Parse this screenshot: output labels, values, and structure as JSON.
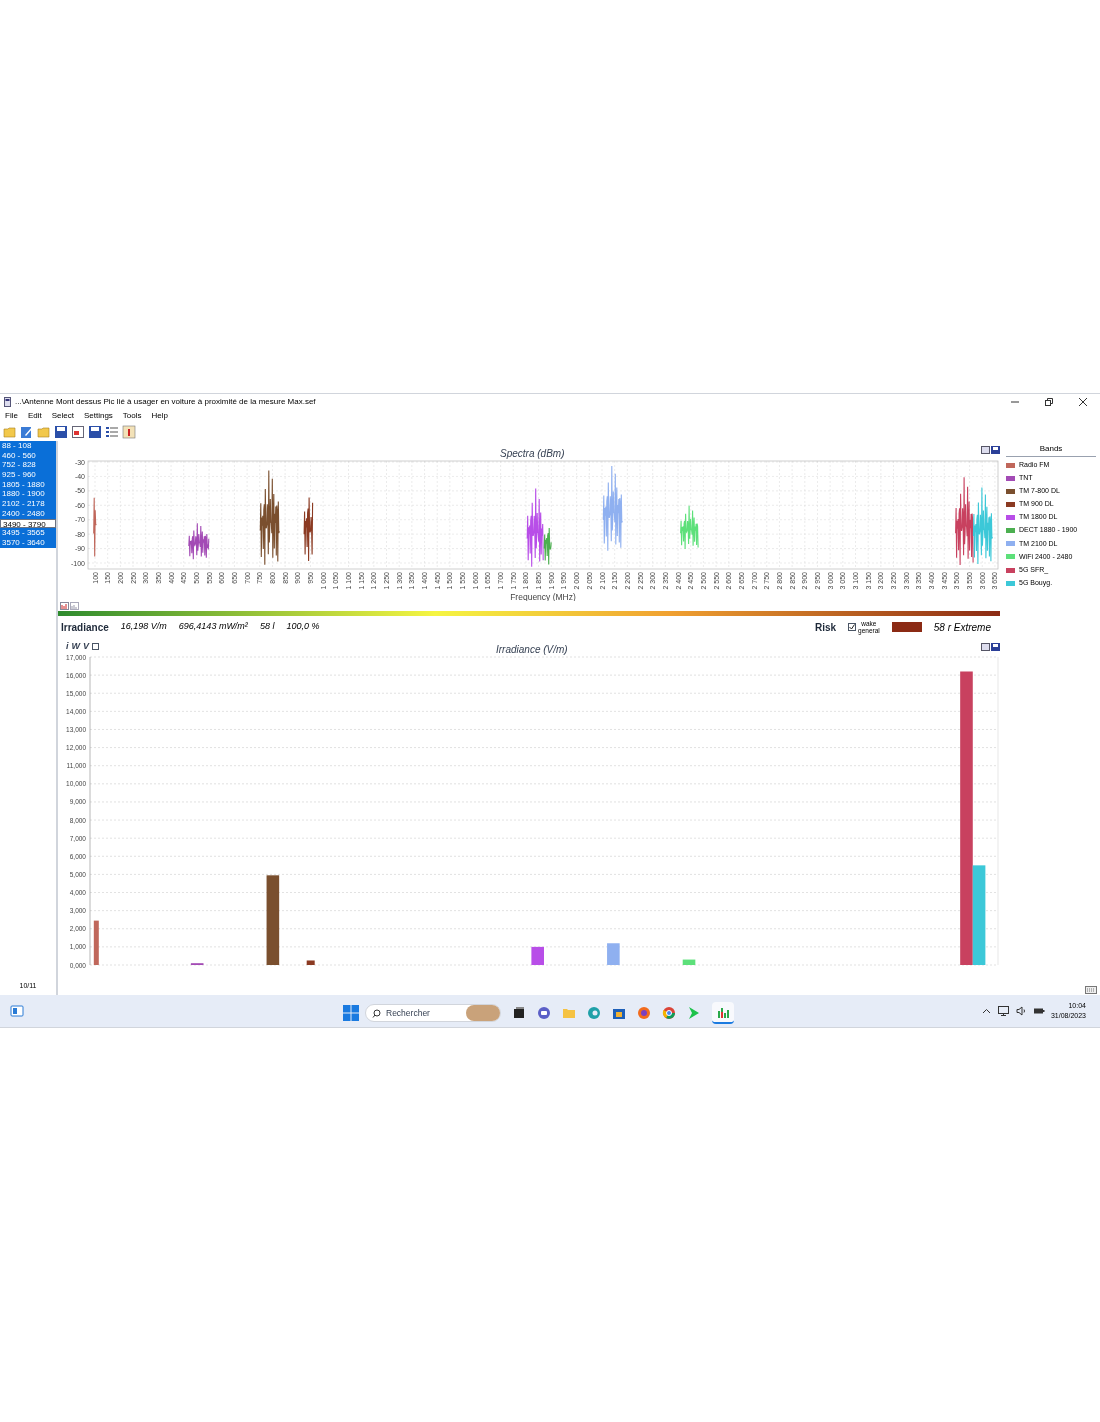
{
  "window": {
    "title": "...\\Antenne Mont dessus Pic lié à usager en voiture à proximité de la mesure Max.sef"
  },
  "menu": [
    "File",
    "Edit",
    "Select",
    "Settings",
    "Tools",
    "Help"
  ],
  "ranges": [
    {
      "label": "88 - 108",
      "selected": true
    },
    {
      "label": "460 - 560",
      "selected": true
    },
    {
      "label": "752 - 828",
      "selected": true
    },
    {
      "label": "925 - 960",
      "selected": true
    },
    {
      "label": "1805 - 1880",
      "selected": true
    },
    {
      "label": "1880 - 1900",
      "selected": true
    },
    {
      "label": "2102 - 2178",
      "selected": true
    },
    {
      "label": "2400 - 2480",
      "selected": true
    },
    {
      "label": "3490 - 3790",
      "selected": false
    },
    {
      "label": "3495 - 3565",
      "selected": true
    },
    {
      "label": "3570 - 3640",
      "selected": true
    }
  ],
  "spectra": {
    "title": "Spectra (dBm)",
    "xlabel": "Frequency (MHz)",
    "yticks": [
      "-30",
      "-40",
      "-50",
      "-60",
      "-70",
      "-80",
      "-90",
      "-100"
    ],
    "xticks": [
      "100",
      "150",
      "200",
      "250",
      "300",
      "350",
      "400",
      "450",
      "500",
      "550",
      "600",
      "650",
      "700",
      "750",
      "800",
      "850",
      "900",
      "950",
      "1 000",
      "1 050",
      "1 100",
      "1 150",
      "1 200",
      "1 250",
      "1 300",
      "1 350",
      "1 400",
      "1 450",
      "1 500",
      "1 550",
      "1 600",
      "1 650",
      "1 700",
      "1 750",
      "1 800",
      "1 850",
      "1 900",
      "1 950",
      "2 000",
      "2 050",
      "2 100",
      "2 150",
      "2 200",
      "2 250",
      "2 300",
      "2 350",
      "2 400",
      "2 450",
      "2 500",
      "2 550",
      "2 600",
      "2 650",
      "2 700",
      "2 750",
      "2 800",
      "2 850",
      "2 900",
      "2 950",
      "3 000",
      "3 050",
      "3 100",
      "3 150",
      "3 200",
      "3 250",
      "3 300",
      "3 350",
      "3 400",
      "3 450",
      "3 500",
      "3 550",
      "3 600",
      "3 650"
    ]
  },
  "summary": {
    "label": "Irradiance",
    "field": "16,198 V/m",
    "power": "696,4143 mW/m²",
    "count": "58 l",
    "percent": "100,0 %"
  },
  "risk": {
    "label": "Risk",
    "checked": true,
    "options": [
      "wake",
      "general"
    ],
    "value": "58 r Extreme"
  },
  "units": {
    "options": [
      "i",
      "W",
      "V"
    ],
    "checked": false
  },
  "irradiance_chart": {
    "legend_title": "Bands",
    "chart_data": {
      "type": "bar",
      "title": "Irradiance (V/m)",
      "categories": [
        null,
        null,
        null,
        null,
        null,
        null,
        null,
        null,
        null,
        null,
        null,
        null,
        null,
        null,
        null,
        null,
        null,
        null,
        null,
        null,
        null,
        null,
        null,
        null,
        null,
        null,
        null,
        null,
        null,
        null,
        null,
        null,
        null,
        null,
        null,
        null,
        null,
        null,
        null,
        null,
        null,
        null,
        null,
        null,
        null,
        null,
        null,
        null,
        null,
        null,
        null,
        null,
        null,
        null,
        null,
        null,
        null,
        null,
        null,
        null,
        null,
        null,
        null,
        null,
        null,
        null,
        null,
        null,
        null,
        null,
        null,
        null
      ],
      "series": [
        {
          "name": "Radio FM",
          "color": "#c0675b",
          "values": [
            2.45,
            null,
            null,
            null,
            null,
            null,
            null,
            null,
            null,
            null,
            null,
            null,
            null,
            null,
            null,
            null,
            null,
            null,
            null,
            null,
            null,
            null,
            null,
            null,
            null,
            null,
            null,
            null,
            null,
            null,
            null,
            null,
            null,
            null,
            null,
            null,
            null,
            null,
            null,
            null,
            null,
            null,
            null,
            null,
            null,
            null,
            null,
            null,
            null,
            null,
            null,
            null,
            null,
            null,
            null,
            null,
            null,
            null,
            null,
            null,
            null,
            null,
            null,
            null,
            null,
            null,
            null,
            null,
            null,
            null,
            null,
            null
          ]
        },
        {
          "name": "TNT",
          "color": "#a34bb5",
          "values": [
            null,
            null,
            null,
            null,
            null,
            null,
            null,
            null,
            0.1,
            null,
            null,
            null,
            null,
            null,
            null,
            null,
            null,
            null,
            null,
            null,
            null,
            null,
            null,
            null,
            null,
            null,
            null,
            null,
            null,
            null,
            null,
            null,
            null,
            null,
            null,
            null,
            null,
            null,
            null,
            null,
            null,
            null,
            null,
            null,
            null,
            null,
            null,
            null,
            null,
            null,
            null,
            null,
            null,
            null,
            null,
            null,
            null,
            null,
            null,
            null,
            null,
            null,
            null,
            null,
            null,
            null,
            null,
            null,
            null,
            null,
            null,
            null
          ]
        },
        {
          "name": "TM 7-800 DL",
          "color": "#7a4f2e",
          "values": [
            null,
            null,
            null,
            null,
            null,
            null,
            null,
            null,
            null,
            null,
            null,
            null,
            null,
            null,
            4.95,
            null,
            null,
            null,
            null,
            null,
            null,
            null,
            null,
            null,
            null,
            null,
            null,
            null,
            null,
            null,
            null,
            null,
            null,
            null,
            null,
            null,
            null,
            null,
            null,
            null,
            null,
            null,
            null,
            null,
            null,
            null,
            null,
            null,
            null,
            null,
            null,
            null,
            null,
            null,
            null,
            null,
            null,
            null,
            null,
            null,
            null,
            null,
            null,
            null,
            null,
            null,
            null,
            null,
            null,
            null,
            null,
            null
          ]
        },
        {
          "name": "TM 900 DL",
          "color": "#8b3a22",
          "values": [
            null,
            null,
            null,
            null,
            null,
            null,
            null,
            null,
            null,
            null,
            null,
            null,
            null,
            null,
            null,
            null,
            null,
            0.25,
            null,
            null,
            null,
            null,
            null,
            null,
            null,
            null,
            null,
            null,
            null,
            null,
            null,
            null,
            null,
            null,
            null,
            null,
            null,
            null,
            null,
            null,
            null,
            null,
            null,
            null,
            null,
            null,
            null,
            null,
            null,
            null,
            null,
            null,
            null,
            null,
            null,
            null,
            null,
            null,
            null,
            null,
            null,
            null,
            null,
            null,
            null,
            null,
            null,
            null,
            null,
            null,
            null,
            null
          ]
        },
        {
          "name": "TM 1800 DL",
          "color": "#b84ee8",
          "values": [
            null,
            null,
            null,
            null,
            null,
            null,
            null,
            null,
            null,
            null,
            null,
            null,
            null,
            null,
            null,
            null,
            null,
            null,
            null,
            null,
            null,
            null,
            null,
            null,
            null,
            null,
            null,
            null,
            null,
            null,
            null,
            null,
            null,
            null,
            null,
            1.0,
            null,
            null,
            null,
            null,
            null,
            null,
            null,
            null,
            null,
            null,
            null,
            null,
            null,
            null,
            null,
            null,
            null,
            null,
            null,
            null,
            null,
            null,
            null,
            null,
            null,
            null,
            null,
            null,
            null,
            null,
            null,
            null,
            null,
            null,
            null,
            null
          ]
        },
        {
          "name": "DECT 1880 - 1900",
          "color": "#4caf50",
          "values": [
            null,
            null,
            null,
            null,
            null,
            null,
            null,
            null,
            null,
            null,
            null,
            null,
            null,
            null,
            null,
            null,
            null,
            null,
            null,
            null,
            null,
            null,
            null,
            null,
            null,
            null,
            null,
            null,
            null,
            null,
            null,
            null,
            null,
            null,
            null,
            null,
            null,
            null,
            null,
            null,
            null,
            null,
            null,
            null,
            null,
            null,
            null,
            null,
            null,
            null,
            null,
            null,
            null,
            null,
            null,
            null,
            null,
            null,
            null,
            null,
            null,
            null,
            null,
            null,
            null,
            null,
            null,
            null,
            null,
            null,
            null,
            null
          ]
        },
        {
          "name": "TM 2100 DL",
          "color": "#8fb0f0",
          "values": [
            null,
            null,
            null,
            null,
            null,
            null,
            null,
            null,
            null,
            null,
            null,
            null,
            null,
            null,
            null,
            null,
            null,
            null,
            null,
            null,
            null,
            null,
            null,
            null,
            null,
            null,
            null,
            null,
            null,
            null,
            null,
            null,
            null,
            null,
            null,
            null,
            null,
            null,
            null,
            null,
            null,
            1.2,
            null,
            null,
            null,
            null,
            null,
            null,
            null,
            null,
            null,
            null,
            null,
            null,
            null,
            null,
            null,
            null,
            null,
            null,
            null,
            null,
            null,
            null,
            null,
            null,
            null,
            null,
            null,
            null,
            null,
            null
          ]
        },
        {
          "name": "WiFi 2400 - 2480",
          "color": "#5de07a",
          "values": [
            null,
            null,
            null,
            null,
            null,
            null,
            null,
            null,
            null,
            null,
            null,
            null,
            null,
            null,
            null,
            null,
            null,
            null,
            null,
            null,
            null,
            null,
            null,
            null,
            null,
            null,
            null,
            null,
            null,
            null,
            null,
            null,
            null,
            null,
            null,
            null,
            null,
            null,
            null,
            null,
            null,
            null,
            null,
            null,
            null,
            null,
            null,
            0.3,
            null,
            null,
            null,
            null,
            null,
            null,
            null,
            null,
            null,
            null,
            null,
            null,
            null,
            null,
            null,
            null,
            null,
            null,
            null,
            null,
            null,
            null,
            null,
            null
          ]
        },
        {
          "name": "5G SFR_",
          "color": "#c8415f",
          "values": [
            null,
            null,
            null,
            null,
            null,
            null,
            null,
            null,
            null,
            null,
            null,
            null,
            null,
            null,
            null,
            null,
            null,
            null,
            null,
            null,
            null,
            null,
            null,
            null,
            null,
            null,
            null,
            null,
            null,
            null,
            null,
            null,
            null,
            null,
            null,
            null,
            null,
            null,
            null,
            null,
            null,
            null,
            null,
            null,
            null,
            null,
            null,
            null,
            null,
            null,
            null,
            null,
            null,
            null,
            null,
            null,
            null,
            null,
            null,
            null,
            null,
            null,
            null,
            null,
            null,
            null,
            null,
            null,
            null,
            16.2,
            null,
            null
          ]
        },
        {
          "name": "5G Bouyg.",
          "color": "#3cc8d8",
          "values": [
            null,
            null,
            null,
            null,
            null,
            null,
            null,
            null,
            null,
            null,
            null,
            null,
            null,
            null,
            null,
            null,
            null,
            null,
            null,
            null,
            null,
            null,
            null,
            null,
            null,
            null,
            null,
            null,
            null,
            null,
            null,
            null,
            null,
            null,
            null,
            null,
            null,
            null,
            null,
            null,
            null,
            null,
            null,
            null,
            null,
            null,
            null,
            null,
            null,
            null,
            null,
            null,
            null,
            null,
            null,
            null,
            null,
            null,
            null,
            null,
            null,
            null,
            null,
            null,
            null,
            null,
            null,
            null,
            null,
            null,
            5.5,
            null
          ]
        }
      ],
      "ylim": [
        0,
        17
      ],
      "grid": true,
      "yticks": [
        {
          "value": 0,
          "label": "0,000"
        },
        {
          "value": 1,
          "label": "1,000"
        },
        {
          "value": 2,
          "label": "2,000"
        },
        {
          "value": 3,
          "label": "3,000"
        },
        {
          "value": 4,
          "label": "4,000"
        },
        {
          "value": 5,
          "label": "5,000"
        },
        {
          "value": 6,
          "label": "6,000"
        },
        {
          "value": 7,
          "label": "7,000"
        },
        {
          "value": 8,
          "label": "8,000"
        },
        {
          "value": 9,
          "label": "9,000"
        },
        {
          "value": 10,
          "label": "10,000"
        },
        {
          "value": 11,
          "label": "11,000"
        },
        {
          "value": 12,
          "label": "12,000"
        },
        {
          "value": 13,
          "label": "13,000"
        },
        {
          "value": 14,
          "label": "14,000"
        },
        {
          "value": 15,
          "label": "15,000"
        },
        {
          "value": 16,
          "label": "16,000"
        },
        {
          "value": 17,
          "label": "17,000"
        }
      ]
    }
  },
  "status": {
    "counter": "10/11"
  },
  "taskbar": {
    "search_placeholder": "Rechercher",
    "time": "10:04",
    "date": "31/08/2023"
  }
}
